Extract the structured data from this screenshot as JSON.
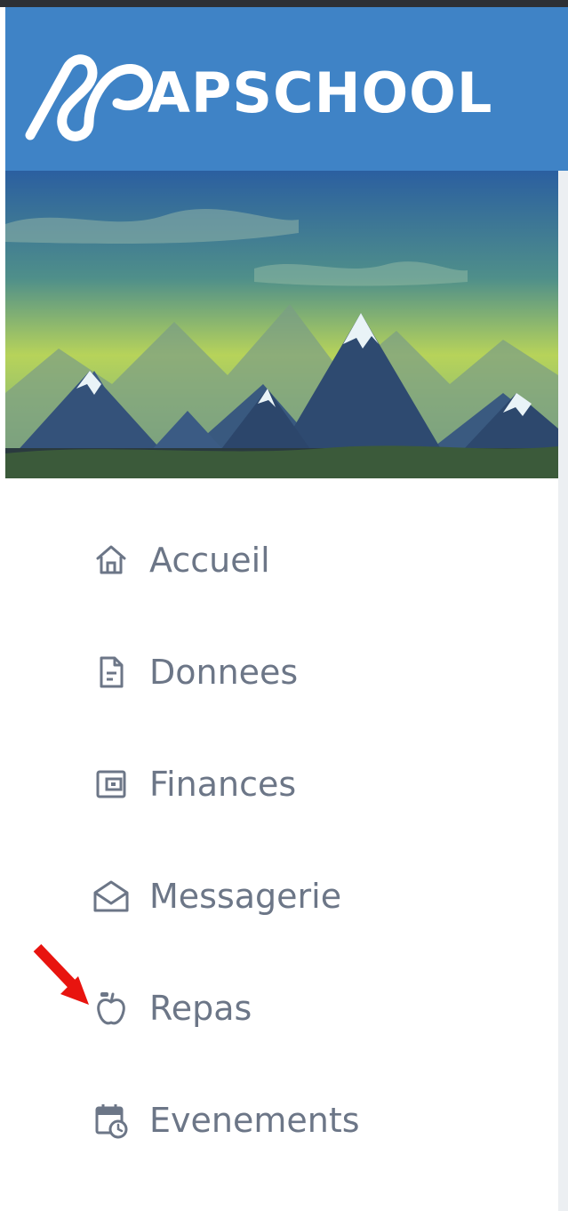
{
  "brand": {
    "name": "APSCHOOL",
    "color": "#3f83c6"
  },
  "sidebar": {
    "items": [
      {
        "label": "Accueil",
        "icon": "home-icon"
      },
      {
        "label": "Donnees",
        "icon": "document-icon"
      },
      {
        "label": "Finances",
        "icon": "wallet-icon"
      },
      {
        "label": "Messagerie",
        "icon": "envelope-open-icon"
      },
      {
        "label": "Repas",
        "icon": "apple-icon"
      },
      {
        "label": "Evenements",
        "icon": "calendar-clock-icon"
      }
    ]
  },
  "annotation": {
    "icon": "red-arrow-icon",
    "color": "#e8140f"
  }
}
